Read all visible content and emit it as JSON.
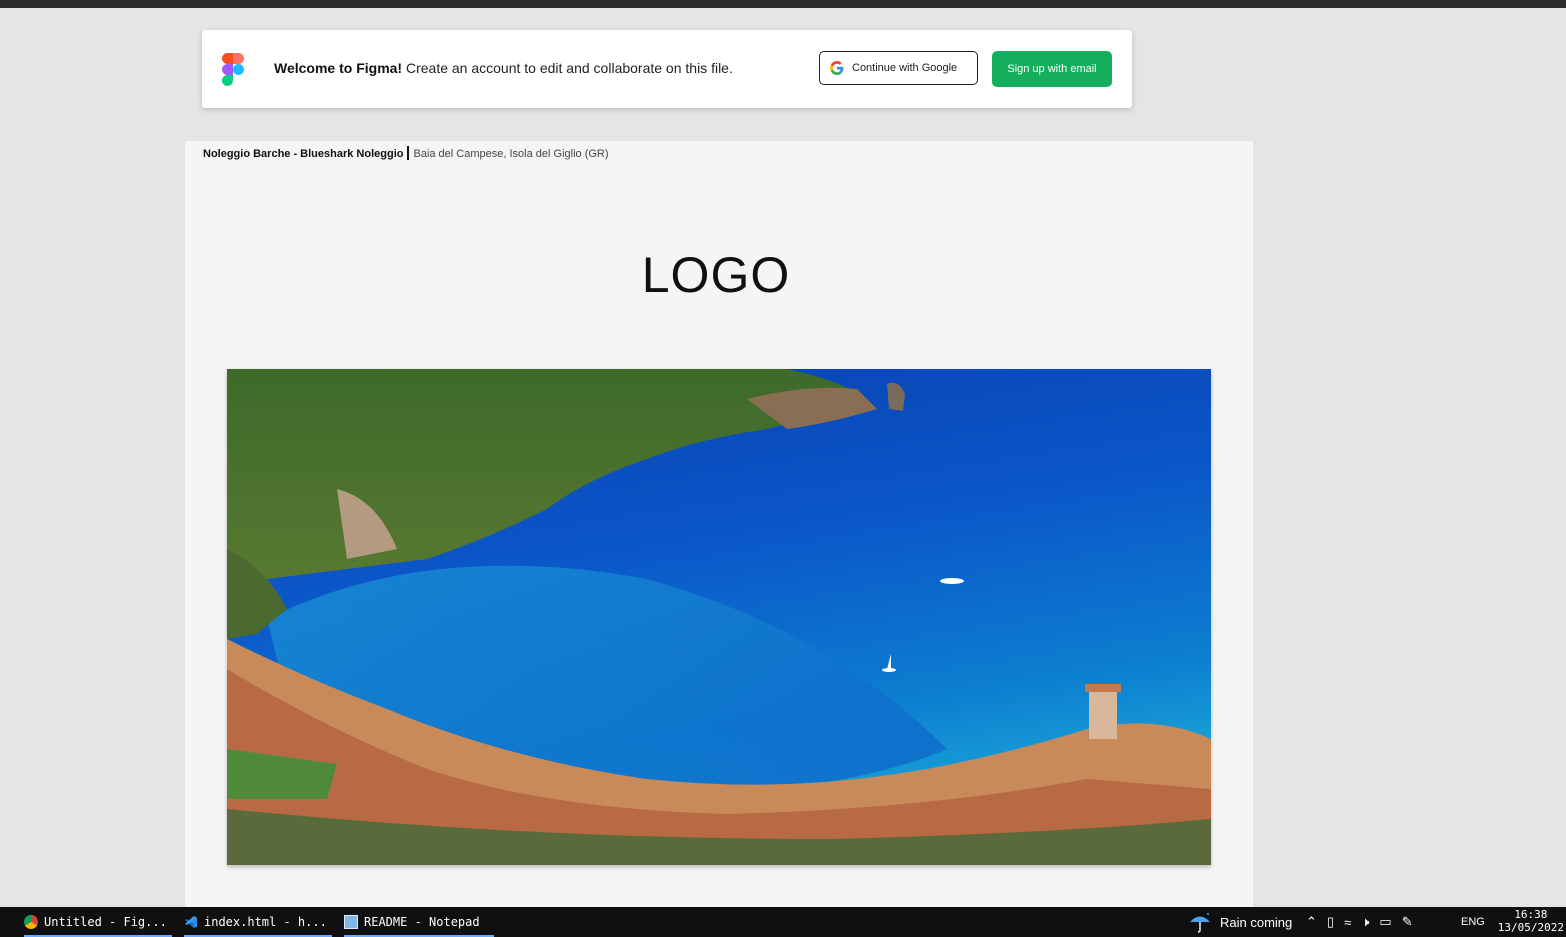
{
  "banner": {
    "welcome_bold": "Welcome to Figma!",
    "welcome_text": "Create an account to edit and collaborate on this file.",
    "google_button": "Continue with Google",
    "email_button": "Sign up with email"
  },
  "frame": {
    "title_bold": "Noleggio Barche - Blueshark Noleggio",
    "title_sub": "Baia del Campese, Isola del Giglio (GR)",
    "logo": "LOGO"
  },
  "taskbar": {
    "tasks": [
      {
        "label": "Untitled - Fig...",
        "icon": "chrome-icon"
      },
      {
        "label": "index.html - h...",
        "icon": "vscode-icon"
      },
      {
        "label": "README - Notepad",
        "icon": "notepad-icon"
      }
    ],
    "weather": "Rain coming",
    "language": "ENG",
    "time": "16:38",
    "date": "13/05/2022"
  },
  "colors": {
    "primary_green": "#14ae5c",
    "taskbar": "#101010",
    "canvas": "#e5e5e5",
    "frame": "#f5f5f5"
  }
}
